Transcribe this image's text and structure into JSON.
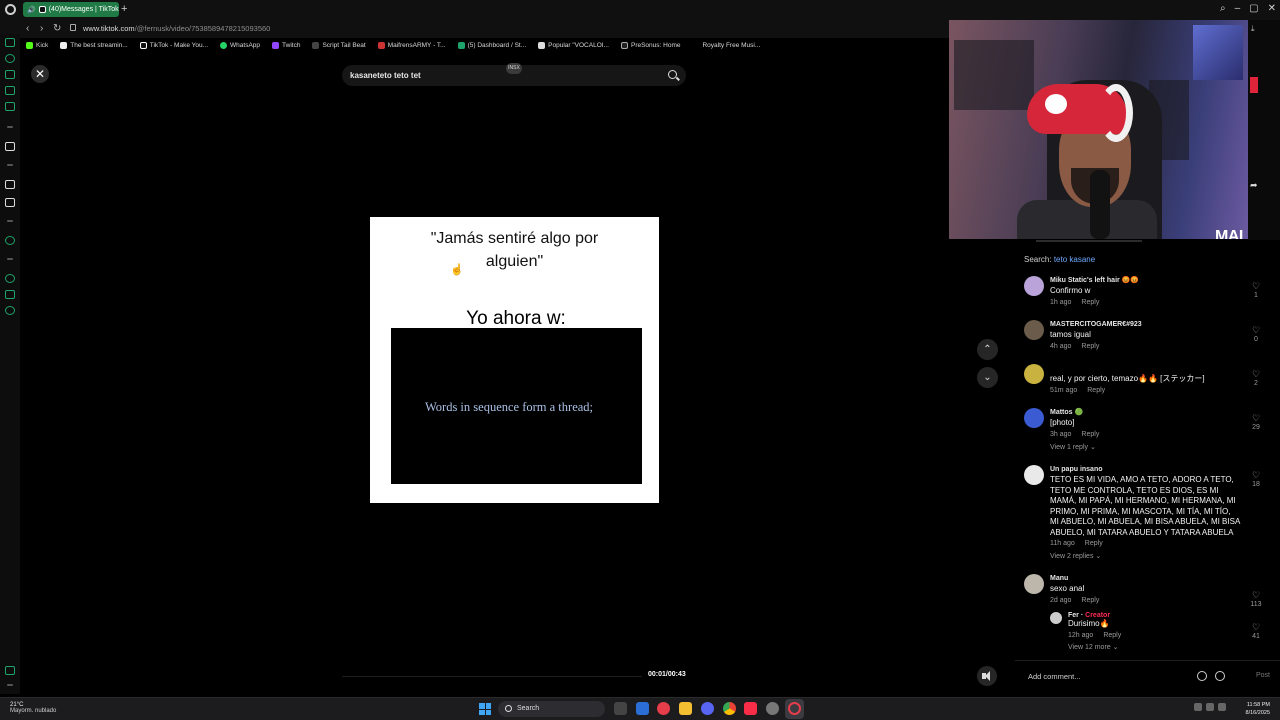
{
  "browser": {
    "tab_title": "(40)Messages | TikTok",
    "url_prefix": "www.tiktok.com",
    "url_path": "/@fernusk/video/7538589478215093560",
    "bookmarks": [
      "Kick",
      "The best streamin...",
      "TikTok - Make You...",
      "WhatsApp",
      "Twitch",
      "Script Tail Beat",
      "MaifrensARMY - T...",
      "(5) Dashboard / St...",
      "Popular \"VOCALOI...",
      "PreSonus: Home",
      "Royalty Free Musi..."
    ]
  },
  "search": {
    "query": "kasaneteto teto tet",
    "badge": "INSX"
  },
  "video": {
    "quote_line1": "\"Jamás sentiré algo por",
    "quote_line2": "alguien\"",
    "caption": "Yo ahora w:",
    "inner_text": "Words in sequence form a thread;",
    "time": "00:01/00:43"
  },
  "webcam": {
    "logo": "MAI"
  },
  "comments_panel": {
    "search_label": "Search:",
    "search_link": "teto kasane",
    "comments": [
      {
        "name": "Miku Static's left hair 😡😡",
        "text": "Confirmo w",
        "time": "1h ago",
        "reply": "Reply",
        "likes": "1",
        "avatar_color": "#b9a3d9"
      },
      {
        "name": "MASTERCITOGAMER€#923",
        "text": "tamos igual",
        "time": "4h ago",
        "reply": "Reply",
        "likes": "0",
        "avatar_color": "#6b5b4a"
      },
      {
        "name": "",
        "text": "real, y por cierto, temazo🔥🔥 [ステッカー]",
        "time": "51m ago",
        "reply": "Reply",
        "likes": "2",
        "avatar_color": "#c9b23f"
      },
      {
        "name": "Mattos 🟢",
        "text": "[photo]",
        "time": "3h ago",
        "reply": "Reply",
        "likes": "29",
        "avatar_color": "#3a5bd1",
        "view_replies": "View 1 reply ⌄"
      },
      {
        "name": "Un papu insano",
        "text": "TETO ES MI VIDA, AMO A TETO, ADORO A TETO, TETO ME CONTROLA, TETO ES DIOS, ES MI MAMÁ, MI PAPÁ, MI HERMANO, MI HERMANA, MI PRIMO, MI PRIMA, MI MASCOTA, MI TÍA, MI TÍO, MI ABUELO, MI ABUELA, MI BISA ABUELA, MI BISA ABUELO, MI TATARA ABUELO Y TATARA ABUELA",
        "time": "11h ago",
        "reply": "Reply",
        "likes": "18",
        "avatar_color": "#e9e9e9",
        "view_replies": "View 2 replies ⌄"
      },
      {
        "name": "Manu",
        "text": "sexo anal",
        "time": "2d ago",
        "reply": "Reply",
        "likes": "113",
        "avatar_color": "#bdb7ab"
      }
    ],
    "nested_reply": {
      "name": "Fer",
      "sep": " · ",
      "tag": "Creator",
      "text": "Durisimo🔥",
      "time": "12h ago",
      "reply": "Reply",
      "likes": "41",
      "more": "View 12 more ⌄"
    },
    "add_comment_placeholder": "Add comment...",
    "post_label": "Post"
  },
  "taskbar": {
    "temp": "21°C",
    "weather": "Mayorm. nublado",
    "search_label": "Search",
    "time": "11:58 PM",
    "date": "8/16/2025"
  },
  "colors": {
    "tab_green": "#1f7a45",
    "creator_red": "#fe2c55",
    "link_blue": "#6fa8ff"
  }
}
